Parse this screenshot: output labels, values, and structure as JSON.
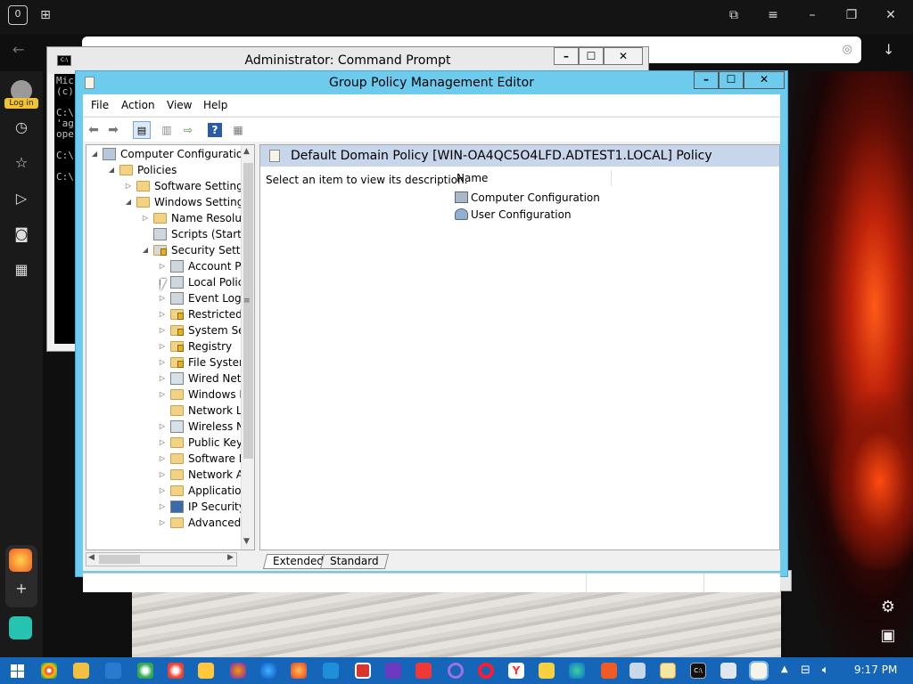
{
  "browser": {
    "tab_count": "0"
  },
  "sidebar": {
    "login_label": "Log in"
  },
  "cmd": {
    "title": "Administrator: Command Prompt",
    "lines": [
      "Mic",
      "(c)",
      "",
      "C:\\",
      "'ag",
      "ope",
      "",
      "C:\\",
      "",
      "C:\\"
    ]
  },
  "gpme": {
    "title": "Group Policy Management Editor",
    "menu": [
      "File",
      "Action",
      "View",
      "Help"
    ],
    "tree": [
      {
        "label": "Computer Configuration",
        "level": 0,
        "expander": "◢",
        "icon": "computer-icon"
      },
      {
        "label": "Policies",
        "level": 1,
        "expander": "◢",
        "icon": "folder-icon"
      },
      {
        "label": "Software Settings",
        "level": 2,
        "expander": "▷",
        "icon": "folder-icon"
      },
      {
        "label": "Windows Settings",
        "level": 2,
        "expander": "◢",
        "icon": "folder-icon"
      },
      {
        "label": "Name Resolut",
        "level": 3,
        "expander": "▷",
        "icon": "folder-icon"
      },
      {
        "label": "Scripts (Startu",
        "level": 3,
        "expander": "",
        "icon": "script-icon"
      },
      {
        "label": "Security Settin",
        "level": 3,
        "expander": "◢",
        "icon": "security-icon"
      },
      {
        "label": "Account P",
        "level": 4,
        "expander": "▷",
        "icon": "policy-icon"
      },
      {
        "label": "Local Polic",
        "level": 4,
        "expander": "▷",
        "icon": "policy-icon"
      },
      {
        "label": "Event Log",
        "level": 4,
        "expander": "▷",
        "icon": "policy-icon"
      },
      {
        "label": "Restricted",
        "level": 4,
        "expander": "▷",
        "icon": "locked-folder-icon"
      },
      {
        "label": "System Se",
        "level": 4,
        "expander": "▷",
        "icon": "locked-folder-icon"
      },
      {
        "label": "Registry",
        "level": 4,
        "expander": "▷",
        "icon": "locked-folder-icon"
      },
      {
        "label": "File Systen",
        "level": 4,
        "expander": "▷",
        "icon": "locked-folder-icon"
      },
      {
        "label": "Wired Net",
        "level": 4,
        "expander": "▷",
        "icon": "network-icon"
      },
      {
        "label": "Windows I",
        "level": 4,
        "expander": "▷",
        "icon": "folder-icon"
      },
      {
        "label": "Network L",
        "level": 4,
        "expander": "",
        "icon": "folder-icon"
      },
      {
        "label": "Wireless N",
        "level": 4,
        "expander": "▷",
        "icon": "network-icon"
      },
      {
        "label": "Public Key",
        "level": 4,
        "expander": "▷",
        "icon": "folder-icon"
      },
      {
        "label": "Software R",
        "level": 4,
        "expander": "▷",
        "icon": "folder-icon"
      },
      {
        "label": "Network A",
        "level": 4,
        "expander": "▷",
        "icon": "folder-icon"
      },
      {
        "label": "Applicatio",
        "level": 4,
        "expander": "▷",
        "icon": "folder-icon"
      },
      {
        "label": "IP Security",
        "level": 4,
        "expander": "▷",
        "icon": "ipsec-icon"
      },
      {
        "label": "Advanced",
        "level": 4,
        "expander": "▷",
        "icon": "folder-icon"
      }
    ],
    "header": "Default Domain Policy [WIN-OA4QC5O4LFD.ADTEST1.LOCAL] Policy",
    "description": "Select an item to view its description.",
    "column_name": "Name",
    "items": [
      "Computer Configuration",
      "User Configuration"
    ],
    "tabs": [
      "Extended",
      "Standard"
    ]
  },
  "taskbar": {
    "clock": "9:17 PM"
  }
}
